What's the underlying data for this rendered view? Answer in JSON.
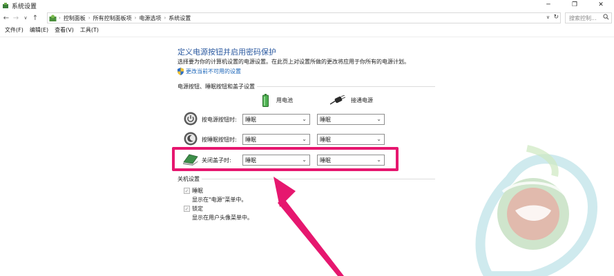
{
  "window": {
    "title": "系统设置",
    "controls": [
      "─",
      "❐",
      "✕"
    ]
  },
  "nav": {
    "back": "←",
    "forward": "→",
    "dropdown": "∨",
    "up": "↑"
  },
  "address": {
    "crumbs": [
      "控制面板",
      "所有控制面板项",
      "电源选项",
      "系统设置"
    ],
    "separator": "›",
    "dropdown": "∨",
    "refresh": "↻"
  },
  "search": {
    "placeholder": "搜索控制..."
  },
  "menu": [
    "文件(F)",
    "编辑(E)",
    "查看(V)",
    "工具(T)"
  ],
  "content": {
    "title": "定义电源按钮并启用密码保护",
    "description": "选择要为你的计算机设置的电源设置。在此页上对设置所做的更改将应用于你所有的电源计划。",
    "unavailable_link": "更改当前不可用的设置",
    "section_buttons": "电源按钮、睡眠按钮和盖子设置",
    "col_battery": "用电池",
    "col_plugged": "接通电源",
    "rows": [
      {
        "label": "按电源按钮时:",
        "battery": "睡眠",
        "plugged": "睡眠"
      },
      {
        "label": "按睡眠按钮时:",
        "battery": "睡眠",
        "plugged": "睡眠"
      },
      {
        "label": "关闭盖子时:",
        "battery": "睡眠",
        "plugged": "睡眠"
      }
    ],
    "dropdown_chevron": "⌄",
    "section_shutdown": "关机设置",
    "shutdown_items": [
      {
        "label": "睡眠",
        "desc": "显示在\"电源\"菜单中。",
        "checked": true
      },
      {
        "label": "锁定",
        "desc": "显示在用户头像菜单中。",
        "checked": true
      }
    ],
    "check_mark": "✓"
  },
  "colors": {
    "title_blue": "#2c5aa0",
    "link_blue": "#1a64b8",
    "highlight": "#e6176f",
    "arrow": "#e6176f"
  }
}
